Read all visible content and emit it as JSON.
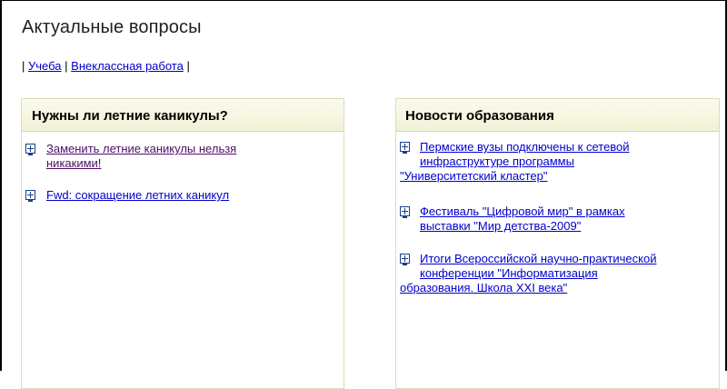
{
  "page": {
    "title": "Актуальные вопросы"
  },
  "breadcrumb": {
    "sep1": "|",
    "link1": "Учеба",
    "sep2": "|",
    "link2": "Внеклассная работа",
    "sep3": "|"
  },
  "left_panel": {
    "title": "Нужны ли летние каникулы?",
    "items": [
      {
        "line1": "Заменить летние каникулы нельзя",
        "line2": "никакими!"
      },
      {
        "line1": "Fwd: сокращение летних каникул"
      }
    ]
  },
  "right_panel": {
    "title": "Новости образования",
    "items": [
      {
        "line1": "Пермские вузы подключены к сетевой",
        "line2": "инфраструктуре программы",
        "line3": "\"Университетский кластер\""
      },
      {
        "line1": "Фестиваль \"Цифровой мир\" в рамках",
        "line2": "выставки \"Мир детства-2009\""
      },
      {
        "line1": "Итоги Всероссийской научно-практической",
        "line2": "конференции \"Информатизация",
        "line3": "образования. Школа XXI века\""
      }
    ]
  },
  "icons": {
    "expand": "plus-box-icon"
  },
  "colors": {
    "link": "#0000cc",
    "visited_link": "#4b0f63",
    "header_bg": "#f1f1d6",
    "panel_border": "#dcdcb8"
  }
}
